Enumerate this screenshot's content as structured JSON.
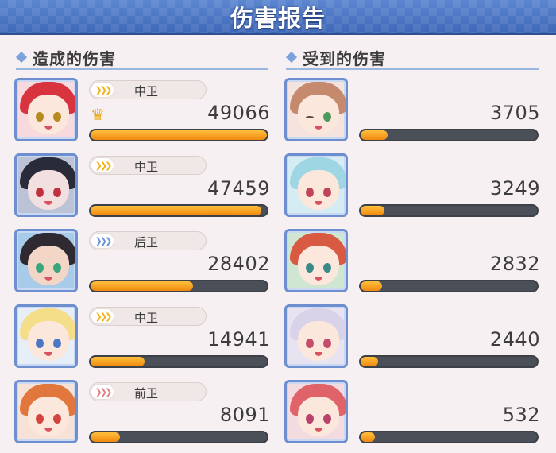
{
  "header": {
    "title": "伤害报告"
  },
  "sections": {
    "dealt_label": "造成的伤害",
    "taken_label": "受到的伤害"
  },
  "damage_dealt": [
    {
      "role": "中卫",
      "role_icon": "chevron-gold-icon",
      "value": "49066",
      "fill": 1.0,
      "top": true
    },
    {
      "role": "中卫",
      "role_icon": "chevron-gold-icon",
      "value": "47459",
      "fill": 0.967,
      "top": false
    },
    {
      "role": "后卫",
      "role_icon": "chevron-blue-icon",
      "value": "28402",
      "fill": 0.579,
      "top": false
    },
    {
      "role": "中卫",
      "role_icon": "chevron-gold-icon",
      "value": "14941",
      "fill": 0.305,
      "top": false
    },
    {
      "role": "前卫",
      "role_icon": "chevron-red-icon",
      "value": "8091",
      "fill": 0.165,
      "top": false
    }
  ],
  "damage_taken": [
    {
      "value": "3705",
      "fill": 0.155
    },
    {
      "value": "3249",
      "fill": 0.135
    },
    {
      "value": "2832",
      "fill": 0.12
    },
    {
      "value": "2440",
      "fill": 0.1
    },
    {
      "value": "532",
      "fill": 0.08
    }
  ],
  "colors": {
    "header_bg": "#4a74c2",
    "bar_fill": "#f39a1a",
    "bar_track": "#4b4f57",
    "avatar_border": "#6d8fd0"
  }
}
